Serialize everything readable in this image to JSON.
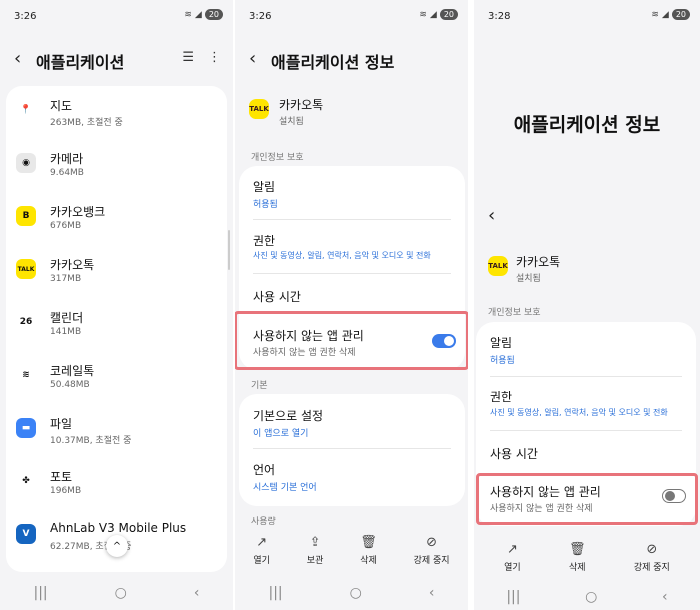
{
  "panel1": {
    "status": {
      "time": "3:26",
      "battery": "20"
    },
    "title": "애플리케이션",
    "apps": [
      {
        "name": "지도",
        "size": "263MB, 초절전 중",
        "icon": "maps-icon",
        "glyph": "📍",
        "bg": "#ffffff"
      },
      {
        "name": "카메라",
        "size": "9.64MB",
        "icon": "camera-icon",
        "glyph": "◉",
        "bg": "#e8e8e8"
      },
      {
        "name": "카카오뱅크",
        "size": "676MB",
        "icon": "kakaobank-icon",
        "glyph": "B",
        "bg": "#fee500"
      },
      {
        "name": "카카오톡",
        "size": "317MB",
        "icon": "kakaotalk-icon",
        "glyph": "TALK",
        "bg": "#fee500"
      },
      {
        "name": "캘린더",
        "size": "141MB",
        "icon": "calendar-icon",
        "glyph": "26",
        "bg": "#ffffff"
      },
      {
        "name": "코레일톡",
        "size": "50.48MB",
        "icon": "korail-icon",
        "glyph": "≋",
        "bg": "#ffffff"
      },
      {
        "name": "파일",
        "size": "10.37MB, 초절전 중",
        "icon": "files-icon",
        "glyph": "▬",
        "bg": "#3b82f6"
      },
      {
        "name": "포토",
        "size": "196MB",
        "icon": "photos-icon",
        "glyph": "✤",
        "bg": "#ffffff"
      },
      {
        "name": "AhnLab V3 Mobile Plus",
        "size": "62.27MB, 초절전 중",
        "icon": "ahnlab-icon",
        "glyph": "V",
        "bg": "#1565c0"
      }
    ]
  },
  "panel2": {
    "status": {
      "time": "3:26",
      "battery": "20"
    },
    "title": "애플리케이션 정보",
    "app_name": "카카오톡",
    "app_status": "설치됨",
    "section_privacy": "개인정보 보호",
    "notification_title": "알림",
    "notification_sub": "허용됨",
    "permission_title": "권한",
    "permission_sub": "사진 및 동영상, 알림, 연락처, 음악 및 오디오 및 전화",
    "usage_time_title": "사용 시간",
    "unused_title": "사용하지 않는 앱 관리",
    "unused_sub": "사용하지 않는 앱 권한 삭제",
    "section_default": "기본",
    "default_title": "기본으로 설정",
    "default_sub": "이 앱으로 열기",
    "language_title": "언어",
    "language_sub": "시스템 기본 언어",
    "section_usage": "사용량",
    "actions": {
      "open": "열기",
      "archive": "보관",
      "delete": "삭제",
      "force_stop": "강제 중지"
    }
  },
  "panel3": {
    "status": {
      "time": "3:28",
      "battery": "20"
    },
    "big_title": "애플리케이션 정보",
    "app_name": "카카오톡",
    "app_status": "설치됨",
    "section_privacy": "개인정보 보호",
    "notification_title": "알림",
    "notification_sub": "허용됨",
    "permission_title": "권한",
    "permission_sub": "사진 및 동영상, 알림, 연락처, 음악 및 오디오 및 전화",
    "usage_time_title": "사용 시간",
    "unused_title": "사용하지 않는 앱 관리",
    "unused_sub": "사용하지 않는 앱 권한 삭제",
    "actions": {
      "open": "열기",
      "delete": "삭제",
      "force_stop": "강제 중지"
    }
  },
  "colors": {
    "accent": "#3a7bea",
    "link": "#2a6fd8",
    "highlight": "#e8737a"
  }
}
